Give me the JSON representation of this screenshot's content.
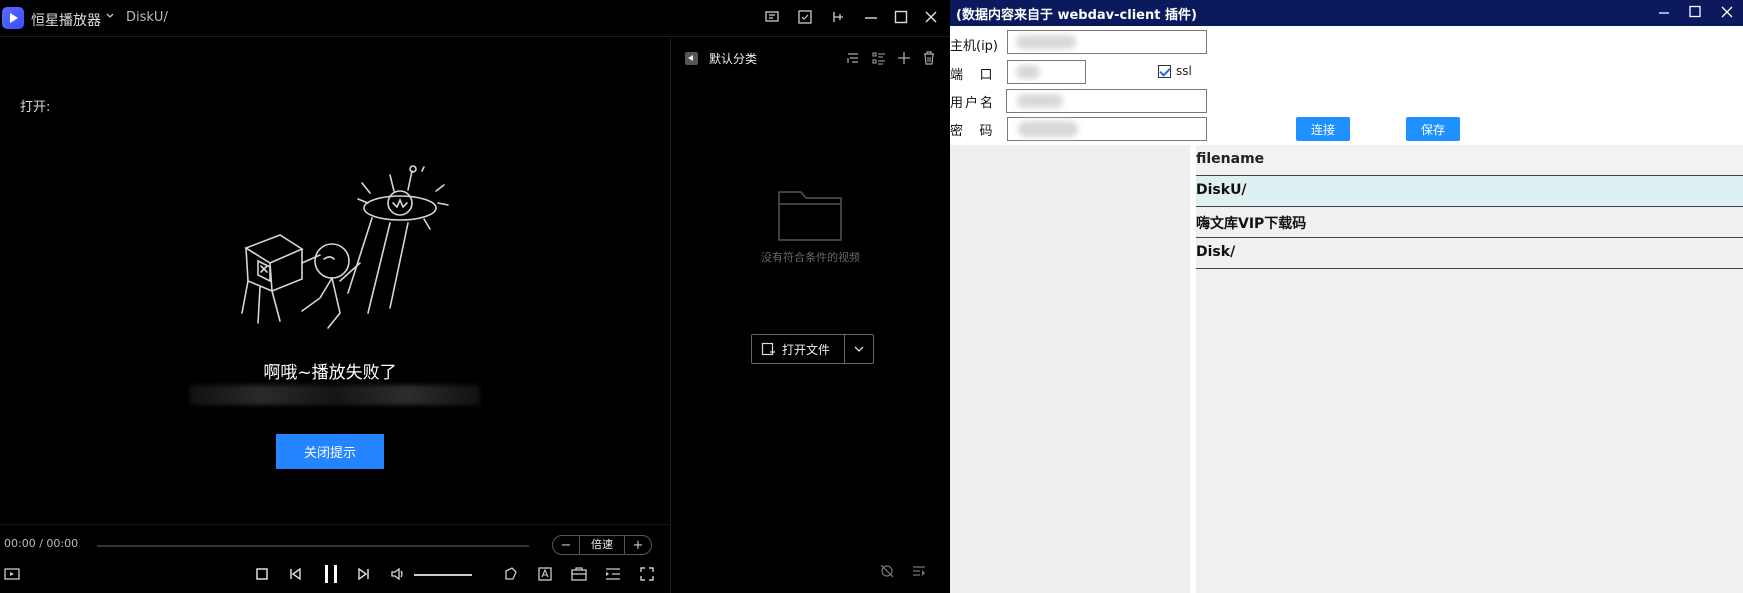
{
  "player": {
    "app_name": "恒星播放器",
    "breadcrumb": "DiskU/",
    "open_label": "打开:",
    "error_title": "啊哦~播放失败了",
    "close_tip_button": "关闭提示",
    "time_text": "00:00 / 00:00",
    "speed_label": "倍速",
    "speed_minus": "−",
    "speed_plus": "+",
    "playlist": {
      "title": "默认分类",
      "empty_text": "没有符合条件的视频",
      "open_file_button": "打开文件"
    },
    "icons": [
      "player-logo-icon",
      "chevron-down-icon",
      "comment-icon",
      "screenshot-icon",
      "pin-icon",
      "minimize-icon",
      "maximize-icon",
      "close-icon",
      "stop-icon",
      "prev-icon",
      "pause-icon",
      "next-icon",
      "volume-icon",
      "volume-slider",
      "cut-icon",
      "subtitle-icon",
      "toolbox-icon",
      "playlist-icon",
      "fullscreen-icon",
      "folder-icon",
      "sort-icon",
      "list-view-icon",
      "add-icon",
      "trash-icon",
      "no-recommend-icon",
      "queue-icon"
    ],
    "colors": {
      "background": "#000000",
      "accent": "#2584ff"
    }
  },
  "webdav": {
    "title": "(数据内容来自于 webdav-client 插件)",
    "host_label": "主机(ip)",
    "port_label": "端    口",
    "user_label": "用户名",
    "password_label": "密    码",
    "ssl_label": "ssl",
    "ssl_checked": true,
    "connect_button": "连接",
    "save_button": "保存",
    "file_header": "filename",
    "files": [
      "DiskU/",
      "嗨文库VIP下载码",
      "Disk/"
    ],
    "selected_file": "DiskU/",
    "colors": {
      "titlebar": "#0a1a5c",
      "button": "#1e90ff",
      "selected_row": "#dff0f2"
    }
  }
}
